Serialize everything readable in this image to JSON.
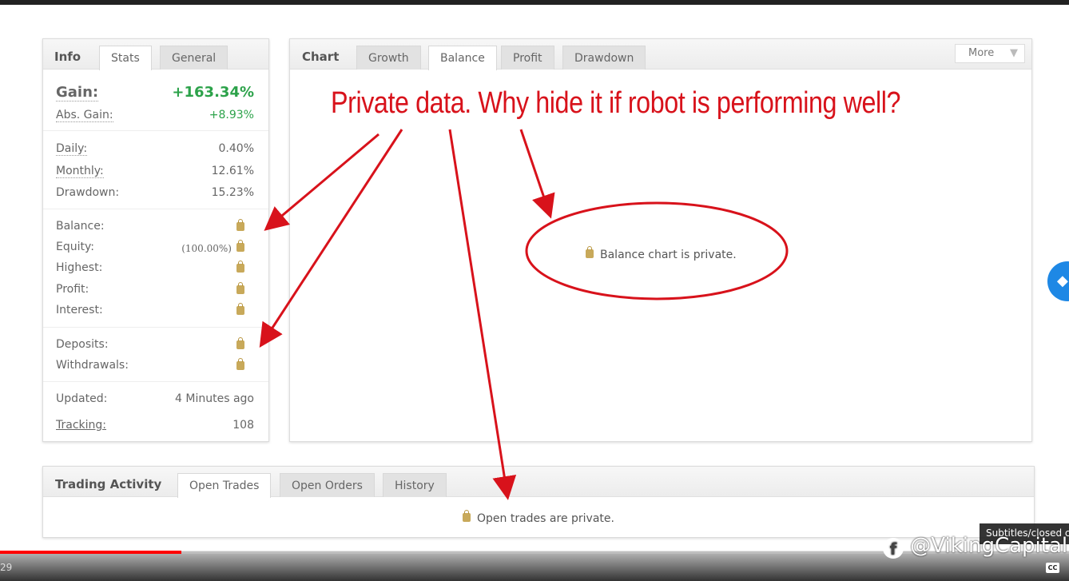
{
  "info": {
    "title": "Info",
    "tabs": [
      "Stats",
      "General"
    ],
    "gain": {
      "label": "Gain:",
      "value": "+163.34%"
    },
    "abs_gain": {
      "label": "Abs. Gain:",
      "value": "+8.93%"
    },
    "daily": {
      "label": "Daily:",
      "value": "0.40%"
    },
    "monthly": {
      "label": "Monthly:",
      "value": "12.61%"
    },
    "drawdown": {
      "label": "Drawdown:",
      "value": "15.23%"
    },
    "balance": {
      "label": "Balance:"
    },
    "equity": {
      "label": "Equity:",
      "value": "(100.00%)"
    },
    "highest": {
      "label": "Highest:"
    },
    "profit": {
      "label": "Profit:"
    },
    "interest": {
      "label": "Interest:"
    },
    "deposits": {
      "label": "Deposits:"
    },
    "withdrawals": {
      "label": "Withdrawals:"
    },
    "updated": {
      "label": "Updated:",
      "value": "4 Minutes ago"
    },
    "tracking": {
      "label": "Tracking:",
      "value": "108"
    }
  },
  "chart": {
    "title": "Chart",
    "tabs": [
      "Growth",
      "Balance",
      "Profit",
      "Drawdown"
    ],
    "active_tab": "Balance",
    "more": "More",
    "private_msg": "Balance chart is private."
  },
  "annotation": {
    "text": "Private data. Why hide it if robot is performing well?",
    "color": "#d8121b"
  },
  "activity": {
    "title": "Trading Activity",
    "tabs": [
      "Open Trades",
      "Open Orders",
      "History"
    ],
    "private_msg": "Open trades are private."
  },
  "video": {
    "time": "29",
    "watermark": "@VikingCapital",
    "tooltip": "Subtitles/closed c",
    "cc": "CC",
    "progress": 0.17
  }
}
